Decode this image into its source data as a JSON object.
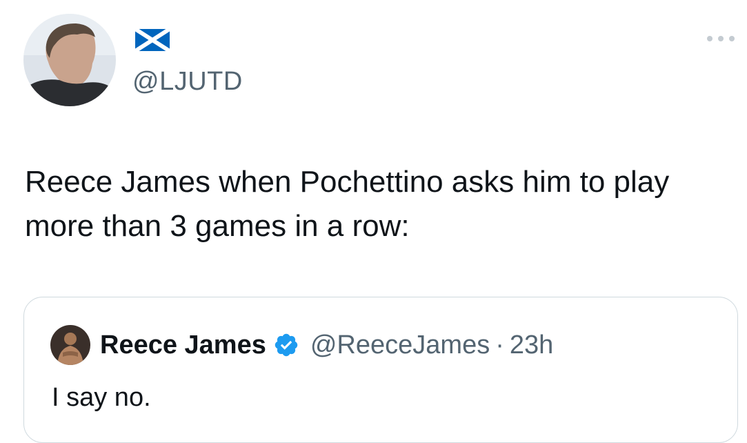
{
  "tweet": {
    "author": {
      "handle": "@LJUTD",
      "display_name_icon": "scotland-flag-icon",
      "avatar": "avatar-photo"
    },
    "more_icon": "more-options-icon",
    "text": "Reece James when Pochettino asks him to play more than 3 games in a row:"
  },
  "quoted_tweet": {
    "author": {
      "name": "Reece James",
      "handle": "@ReeceJames",
      "verified_icon": "verified-badge-icon",
      "avatar": "avatar-photo"
    },
    "separator": "·",
    "time": "23h",
    "text": "I say no."
  },
  "colors": {
    "text_primary": "#0f1419",
    "text_secondary": "#536471",
    "border": "#cfd9de",
    "verified_blue": "#1d9bf0"
  }
}
